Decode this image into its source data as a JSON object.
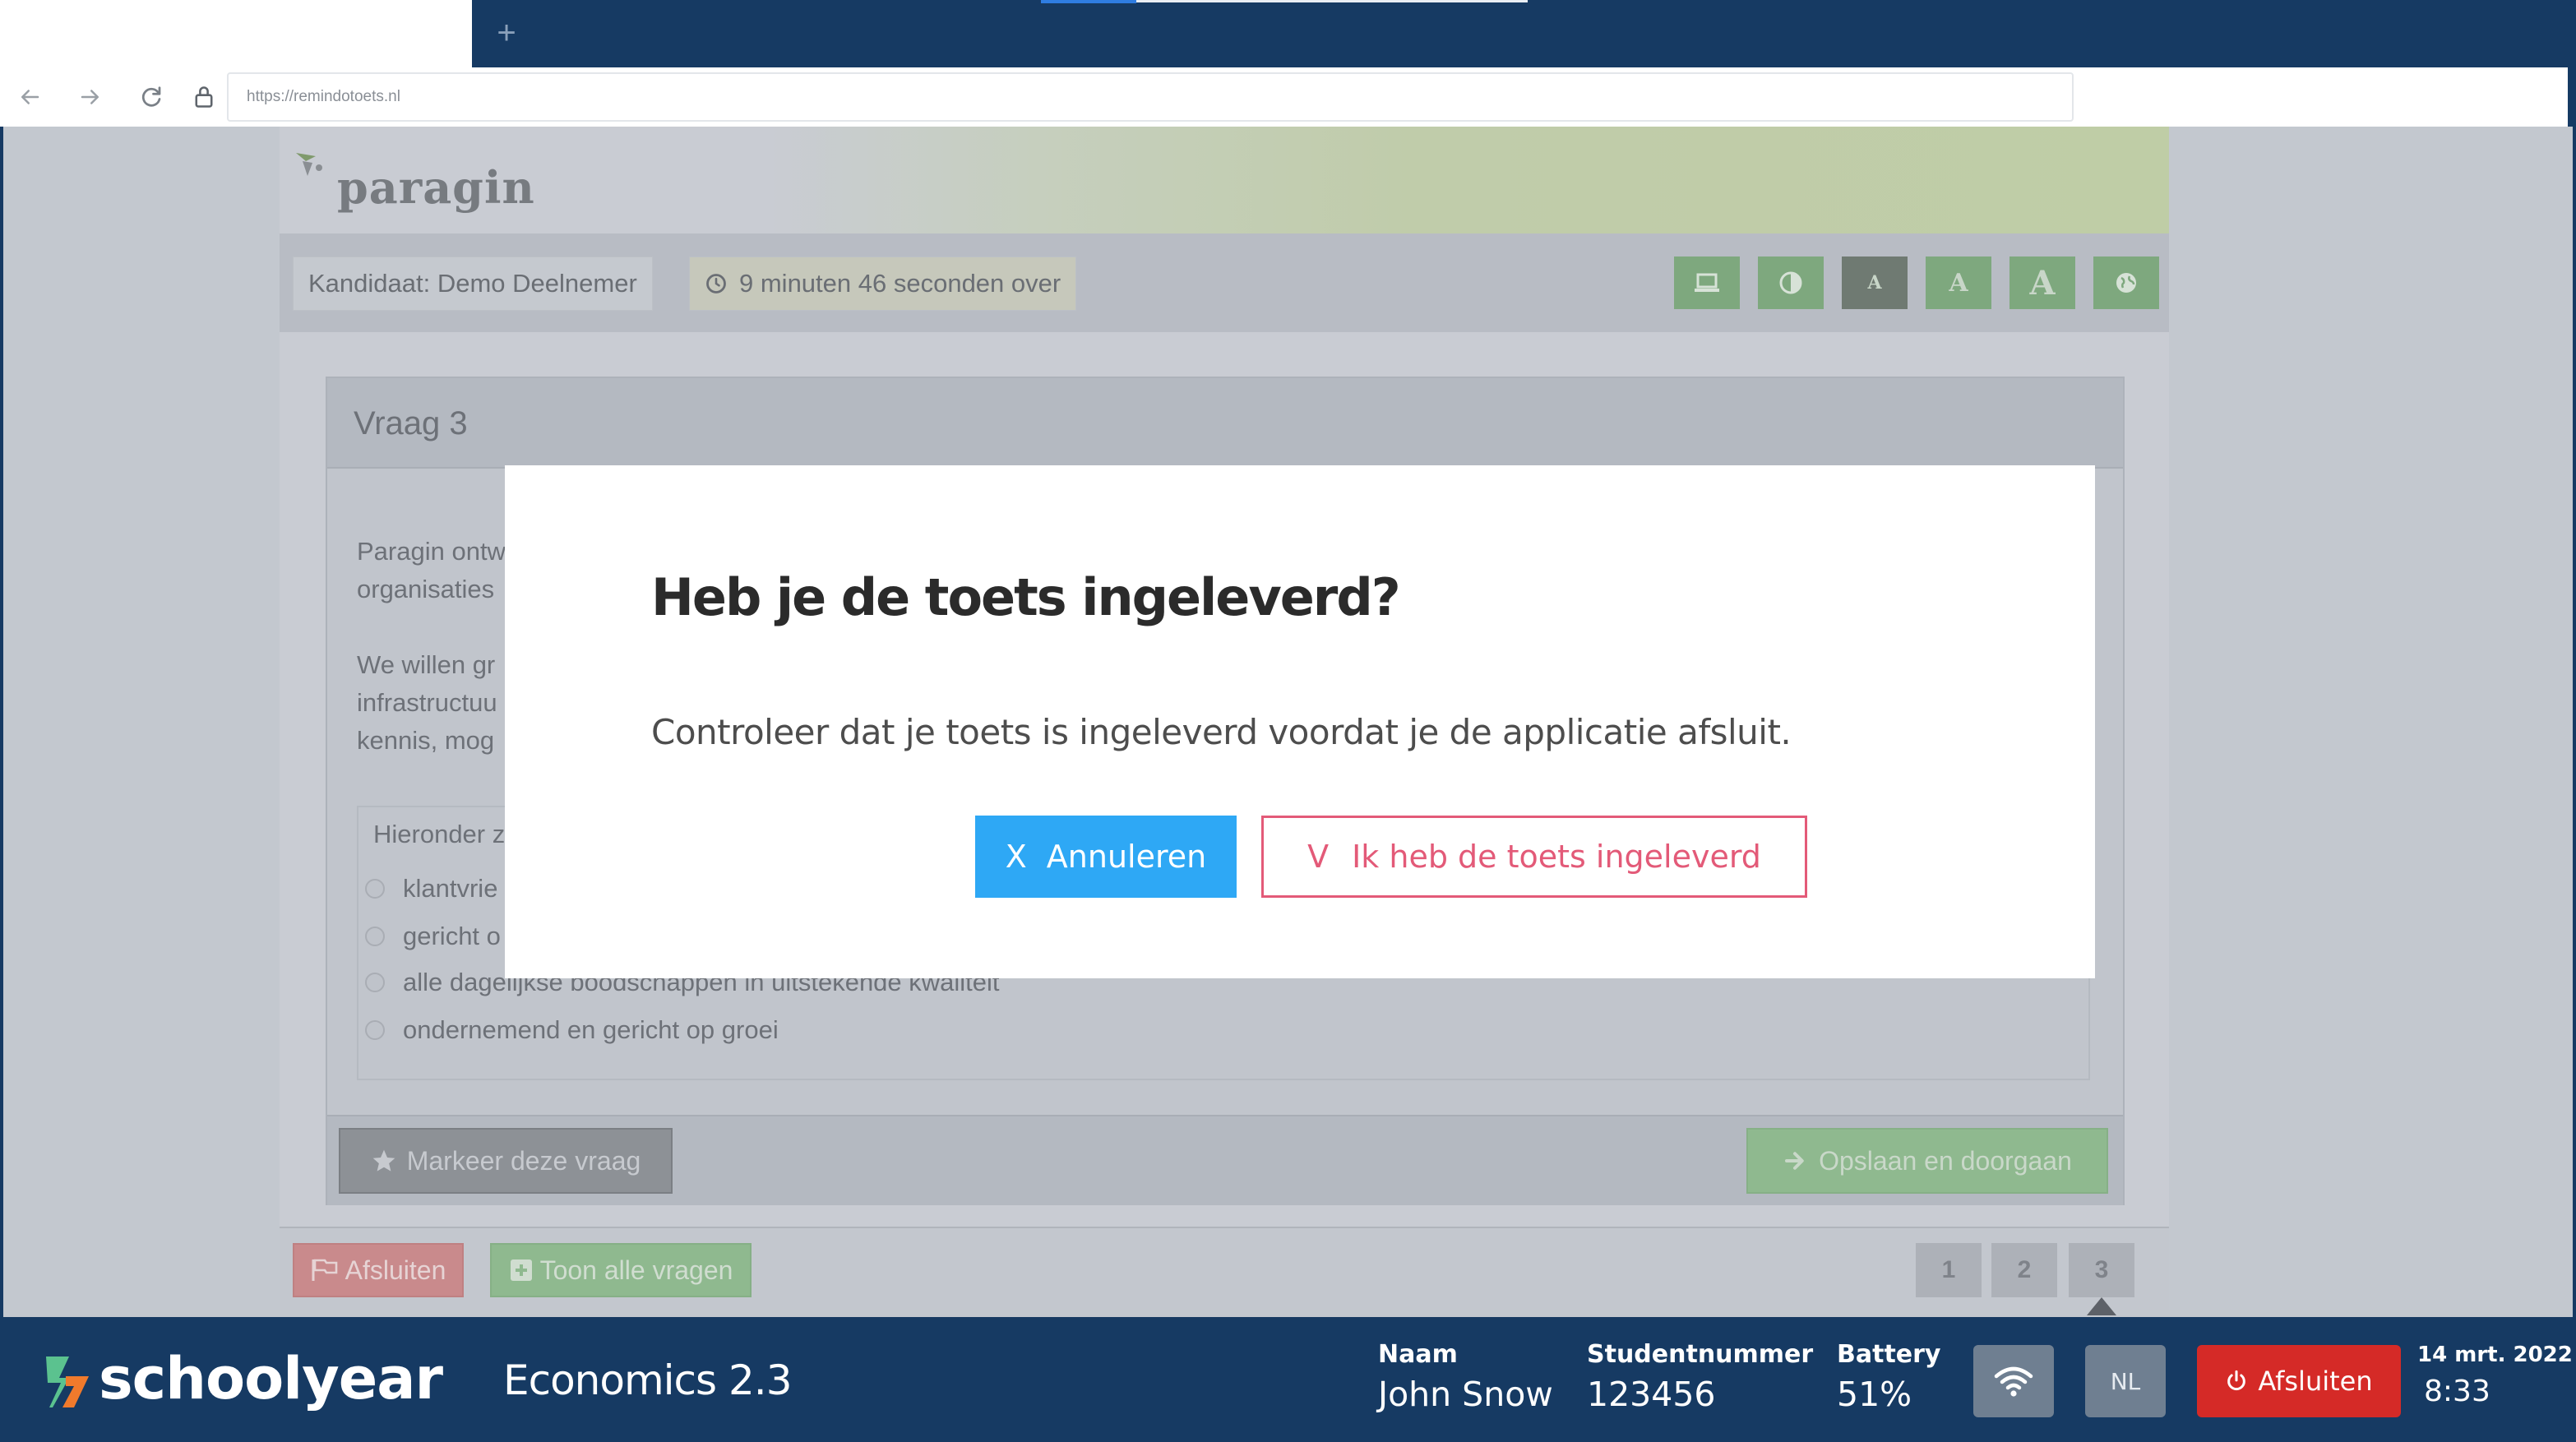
{
  "browser": {
    "new_tab_label": "+",
    "url": "https://remindotoets.nl"
  },
  "exam": {
    "logo_text": "paragin",
    "candidate": "Kandidaat: Demo Deelnemer",
    "time_left": "9 minuten 46 seconden over",
    "toolbar_letter": "A",
    "question": {
      "title": "Vraag 3",
      "paragraph_1": "Paragin ontw\norganisaties",
      "paragraph_2": "We willen gr\ninfrastructuu\nkennis, mog",
      "options_label": "Hieronder z",
      "options": [
        "klantvrie",
        "gericht o",
        "alle dagelijkse boodschappen in uitstekende kwaliteit",
        "ondernemend en gericht op groei"
      ]
    },
    "mark_button": "Markeer deze vraag",
    "save_button": "Opslaan en doorgaan",
    "quit_button": "Afsluiten",
    "show_all_button": "Toon alle vragen",
    "pages": [
      "1",
      "2",
      "3"
    ],
    "current_page": "3"
  },
  "modal": {
    "title": "Heb je de toets ingeleverd?",
    "body": "Controleer dat je toets is ingeleverd voordat je de applicatie afsluit.",
    "cancel_icon": "X",
    "cancel_label": "Annuleren",
    "confirm_icon": "V",
    "confirm_label": "Ik heb de toets ingeleverd"
  },
  "footer": {
    "brand": "schoolyear",
    "course": "Economics 2.3",
    "name_label": "Naam",
    "name_value": "John Snow",
    "student_label": "Studentnummer",
    "student_value": "123456",
    "battery_label": "Battery",
    "battery_value": "51%",
    "language": "NL",
    "quit_label": "Afsluiten",
    "date": "14 mrt. 2022",
    "time": "8:33"
  },
  "colors": {
    "footer_bg": "#163a63",
    "modal_primary": "#2ea8f5",
    "modal_confirm": "#e35a78",
    "quit_red": "#d52a27"
  }
}
